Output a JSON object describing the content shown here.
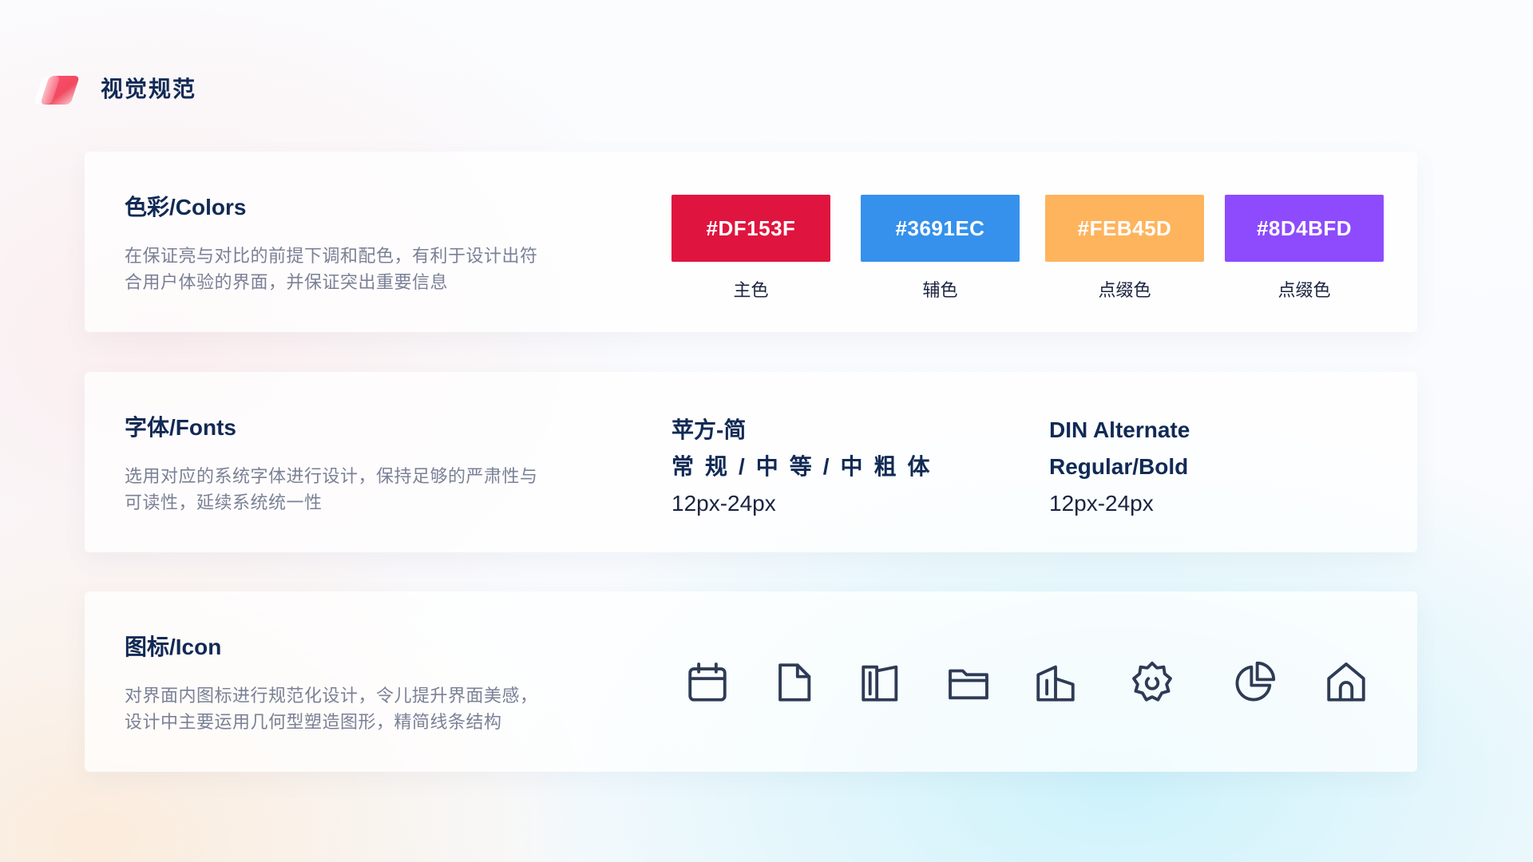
{
  "header": {
    "title": "视觉规范"
  },
  "colors_card": {
    "title": "色彩/Colors",
    "desc_line1": "在保证亮与对比的前提下调和配色，有利于设计出符",
    "desc_line2": "合用户体验的界面，并保证突出重要信息",
    "swatches": [
      {
        "hex": "#DF153F",
        "label": "主色",
        "color": "#DF153F"
      },
      {
        "hex": "#3691EC",
        "label": "辅色",
        "color": "#3691EC"
      },
      {
        "hex": "#FEB45D",
        "label": "点缀色",
        "color": "#FEB45D"
      },
      {
        "hex": "#8D4BFD",
        "label": "点缀色",
        "color": "#8D4BFD"
      }
    ]
  },
  "fonts_card": {
    "title": "字体/Fonts",
    "desc_line1": "选用对应的系统字体进行设计，保持足够的严肃性与",
    "desc_line2": "可读性，延续系统统一性",
    "cn_font": {
      "name": "苹方-简",
      "weights": "常规/中等/中粗体",
      "sizes": "12px-24px"
    },
    "din_font": {
      "name": "DIN Alternate",
      "weights": "Regular/Bold",
      "sizes": "12px-24px"
    }
  },
  "icons_card": {
    "title": "图标/Icon",
    "desc_line1": "对界面内图标进行规范化设计，令儿提升界面美感，",
    "desc_line2": "设计中主要运用几何型塑造图形，精简线条结构",
    "icons": [
      "calendar-icon",
      "document-icon",
      "book-icon",
      "folder-icon",
      "building-icon",
      "settings-gear-icon",
      "pie-chart-icon",
      "home-icon"
    ],
    "icon_color": "#2e3b55"
  }
}
